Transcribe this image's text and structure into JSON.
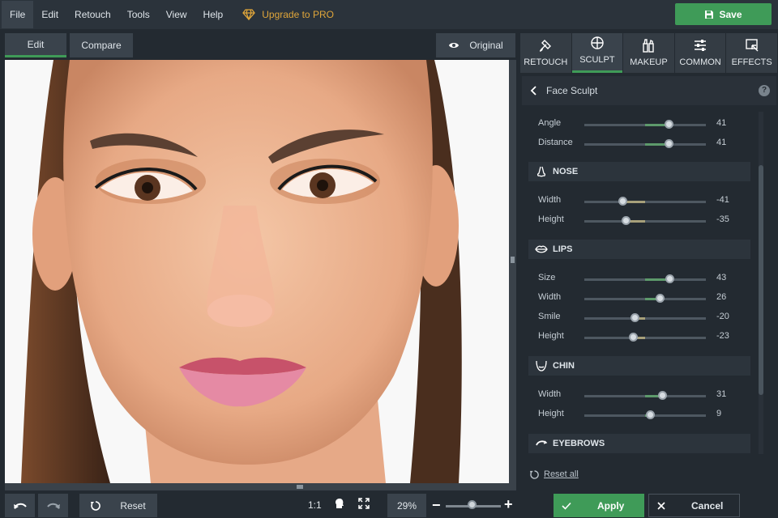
{
  "menu": {
    "items": [
      "File",
      "Edit",
      "Retouch",
      "Tools",
      "View",
      "Help"
    ],
    "upgrade_label": "Upgrade to PRO",
    "save_label": "Save"
  },
  "view_tabs": {
    "edit": "Edit",
    "compare": "Compare",
    "original": "Original"
  },
  "right_tabs": [
    {
      "label": "RETOUCH",
      "icon": "retouch-brush-icon"
    },
    {
      "label": "SCULPT",
      "icon": "sculpt-target-icon"
    },
    {
      "label": "MAKEUP",
      "icon": "makeup-icon"
    },
    {
      "label": "COMMON",
      "icon": "sliders-icon"
    },
    {
      "label": "EFFECTS",
      "icon": "effects-icon"
    }
  ],
  "panel": {
    "title": "Face Sculpt",
    "help": "?",
    "reset_all": "Reset all"
  },
  "sliders": {
    "eyes_angle": {
      "label": "Angle",
      "value": "41",
      "level": 0.69
    },
    "eyes_distance": {
      "label": "Distance",
      "value": "41",
      "level": 0.69
    },
    "nose_header": "NOSE",
    "nose_width": {
      "label": "Width",
      "value": "-41",
      "level": 0.31
    },
    "nose_height": {
      "label": "Height",
      "value": "-35",
      "level": 0.34
    },
    "lips_header": "LIPS",
    "lips_size": {
      "label": "Size",
      "value": "43",
      "level": 0.7
    },
    "lips_width": {
      "label": "Width",
      "value": "26",
      "level": 0.62
    },
    "lips_smile": {
      "label": "Smile",
      "value": "-20",
      "level": 0.41
    },
    "lips_height": {
      "label": "Height",
      "value": "-23",
      "level": 0.4
    },
    "chin_header": "CHIN",
    "chin_width": {
      "label": "Width",
      "value": "31",
      "level": 0.64
    },
    "chin_height": {
      "label": "Height",
      "value": "9",
      "level": 0.54
    },
    "eyebrows_header": "EYEBROWS"
  },
  "bottom": {
    "reset_label": "Reset",
    "ratio": "1:1",
    "zoom": "29%",
    "zoom_level": 0.47,
    "apply_label": "Apply",
    "cancel_label": "Cancel"
  },
  "colors": {
    "accent": "#3f9b58",
    "upgrade": "#e0a63a",
    "slider_positive": "#5d9a6b",
    "slider_negative": "#a7a07a"
  }
}
